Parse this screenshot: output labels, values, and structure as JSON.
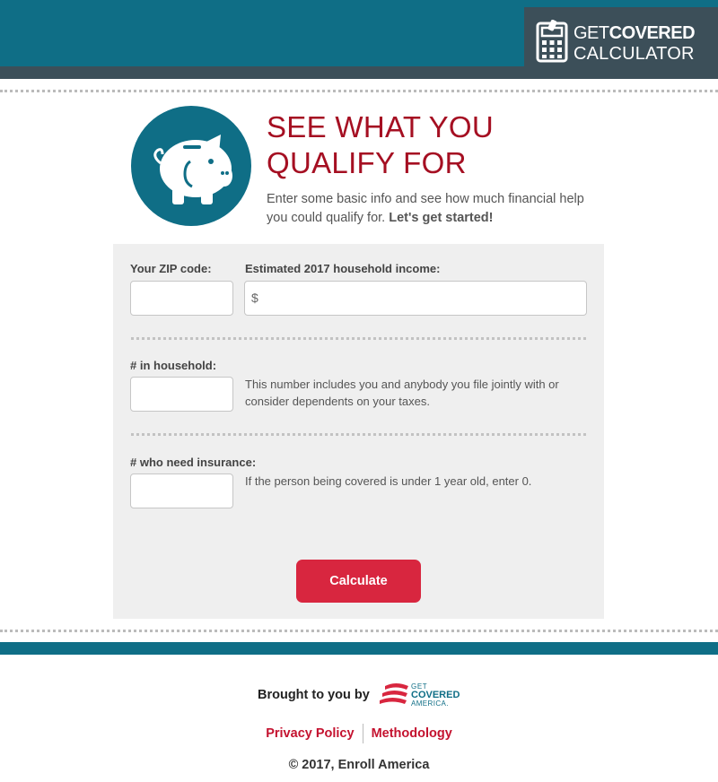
{
  "header": {
    "brand_line1_thin": "GET",
    "brand_line1_bold": "COVERED",
    "brand_line2": "CALCULATOR",
    "brand_icon": "calculator-icon",
    "bar_color": "#0f6e86",
    "brand_bg_color": "#3c4f59"
  },
  "hero": {
    "icon": "piggy-bank-icon",
    "title_line1": "SEE WHAT YOU",
    "title_line2": "QUALIFY FOR",
    "intro_text": "Enter some basic info and see how much financial help you could qualify for.",
    "intro_bold": "Let's get started!",
    "title_color": "#a50f22"
  },
  "form": {
    "zip": {
      "label": "Your ZIP code:",
      "value": ""
    },
    "income": {
      "label": "Estimated 2017 household income:",
      "prefix": "$",
      "value": ""
    },
    "household": {
      "label": "# in household:",
      "value": "",
      "help": "This number includes you and anybody you file jointly with or consider dependents on your taxes."
    },
    "insured": {
      "label": "# who need insurance:",
      "value": "",
      "help": "If the person being covered is under 1 year old, enter 0."
    },
    "calculate_label": "Calculate",
    "button_color": "#d8263f"
  },
  "footer": {
    "brought_by": "Brought to you by",
    "partner_logo": {
      "line1": "GET",
      "line2": "COVERED",
      "line3": "AMERICA."
    },
    "links": [
      "Privacy Policy",
      "Methodology"
    ],
    "copyright": "© 2017, Enroll America",
    "link_color": "#c4122f"
  }
}
